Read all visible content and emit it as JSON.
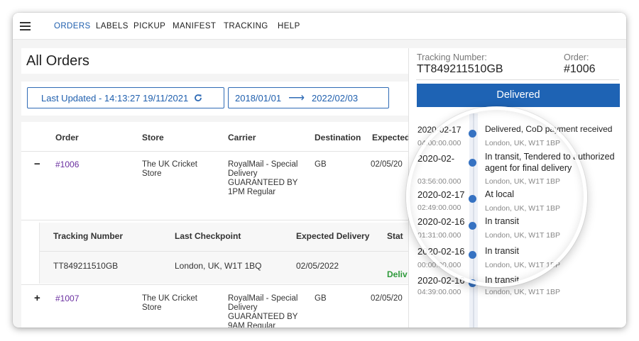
{
  "nav": {
    "menu_icon": "hamburger-menu-icon",
    "items": [
      "ORDERS",
      "LABELS",
      "PICKUP",
      "MANIFEST",
      "TRACKING",
      "HELP"
    ],
    "active": "ORDERS",
    "accent_color": "#1f5fae"
  },
  "page": {
    "title": "All Orders"
  },
  "filters": {
    "last_updated": "Last Updated - 14:13:27 19/11/2021",
    "refresh_icon": "refresh-icon",
    "date_from": "2018/01/01",
    "date_to": "2022/02/03"
  },
  "orders_table": {
    "headers": [
      "Order",
      "Store",
      "Carrier",
      "Destination",
      "Expected"
    ],
    "rows": [
      {
        "toggle": "−",
        "order": "#1006",
        "store": [
          "The UK Cricket",
          "Store"
        ],
        "carrier": [
          "RoyalMail - Special",
          "Delivery",
          "GUARANTEED BY",
          "1PM Regular"
        ],
        "destination": "GB",
        "expected": "02/05/20"
      },
      {
        "toggle": "+",
        "order": "#1007",
        "store": [
          "The UK Cricket",
          "Store"
        ],
        "carrier": [
          "RoyalMail - Special",
          "Delivery",
          "GUARANTEED BY",
          "9AM Regular"
        ],
        "destination": "GB",
        "expected": "02/05/20"
      }
    ]
  },
  "shipment_subtable": {
    "headers": [
      "Tracking Number",
      "Last Checkpoint",
      "Expected Delivery",
      "Stat"
    ],
    "row": {
      "tracking_number": "TT849211510GB",
      "last_checkpoint": "London, UK, W1T 1BQ",
      "expected_delivery": "02/05/2022",
      "status": "Deliv"
    }
  },
  "tracking_panel": {
    "tracking_label": "Tracking Number:",
    "tracking_value": "TT849211510GB",
    "order_label": "Order:",
    "order_value": "#1006",
    "status": "Delivered",
    "status_color": "#1e63b4",
    "events": [
      {
        "date": "2020-02-17",
        "time": "04:00:00.000",
        "status": "Delivered, CoD payment received",
        "location": "London, UK, W1T 1BP"
      },
      {
        "date": "2020-02-",
        "time": "03:56:00.000",
        "status": "In transit, Tendered to authorized",
        "status2": "agent for final delivery",
        "location": "London, UK, W1T 1BP"
      },
      {
        "date": "2020-02-17",
        "time": "02:49:00.000",
        "status": "At local",
        "location": "London, UK, W1T 1BP"
      },
      {
        "date": "2020-02-16",
        "time": "01:31:00.000",
        "status": "In transit",
        "location": "London, UK, W1T 1BP"
      },
      {
        "date": "2020-02-16",
        "time": "00:00:00.000",
        "status": "In transit",
        "location": "London, UK, W1T 1BP"
      },
      {
        "date": "2020-02-16",
        "time": "04:39:00.000",
        "status": "In transit",
        "location": "London, UK, W1T 1BP"
      }
    ]
  }
}
